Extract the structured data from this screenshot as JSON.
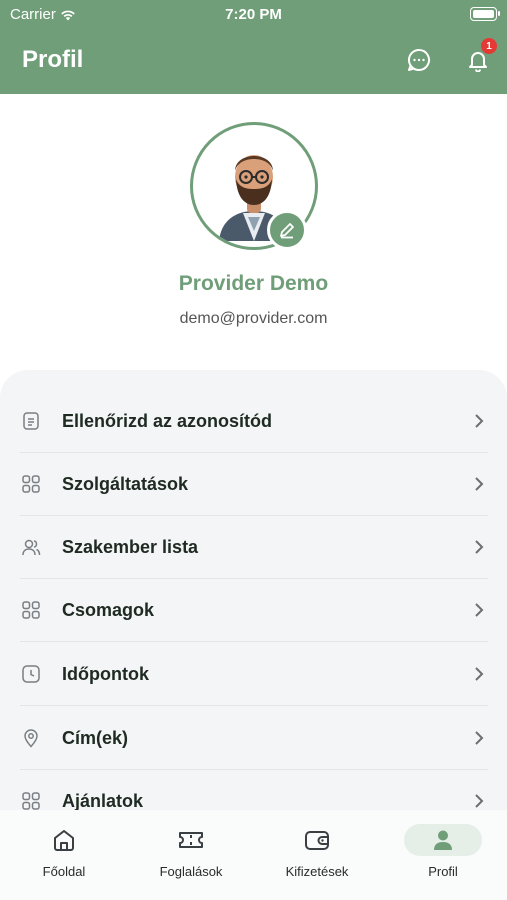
{
  "status_bar": {
    "carrier": "Carrier",
    "time": "7:20 PM"
  },
  "header": {
    "title": "Profil",
    "notification_count": "1"
  },
  "profile": {
    "name": "Provider Demo",
    "email": "demo@provider.com"
  },
  "menu": {
    "items": [
      {
        "label": "Ellenőrizd az azonosítód",
        "icon": "document-icon"
      },
      {
        "label": "Szolgáltatások",
        "icon": "grid-icon"
      },
      {
        "label": "Szakember lista",
        "icon": "users-icon"
      },
      {
        "label": "Csomagok",
        "icon": "grid-icon"
      },
      {
        "label": "Időpontok",
        "icon": "clock-icon"
      },
      {
        "label": "Cím(ek)",
        "icon": "location-pin-icon"
      },
      {
        "label": "Ajánlatok",
        "icon": "grid-icon"
      }
    ]
  },
  "tabbar": {
    "items": [
      {
        "label": "Főoldal",
        "icon": "home-icon"
      },
      {
        "label": "Foglalások",
        "icon": "ticket-icon"
      },
      {
        "label": "Kifizetések",
        "icon": "wallet-icon"
      },
      {
        "label": "Profil",
        "icon": "user-icon",
        "active": true
      }
    ]
  },
  "colors": {
    "primary": "#6f9e78",
    "badge": "#e53935",
    "card_bg": "#f3f5f6"
  }
}
